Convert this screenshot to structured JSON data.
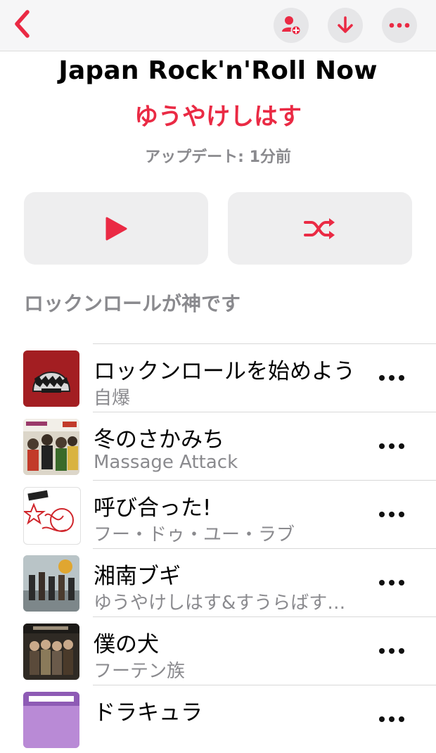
{
  "header": {
    "back_icon": "chevron-left-icon",
    "buttons": [
      "add-person-icon",
      "download-icon",
      "ellipsis-icon"
    ],
    "accent": "#ea2a44"
  },
  "playlist": {
    "title": "Japan Rock'n'Roll Now",
    "curator": "ゆうやけしはす",
    "updated": "アップデート: 1分前",
    "description": "ロックンロールが神です"
  },
  "actions": {
    "play_icon": "play-icon",
    "shuffle_icon": "shuffle-icon"
  },
  "tracks": [
    {
      "title": "ロックンロールを始めよう",
      "artist": "自爆"
    },
    {
      "title": "冬のさかみち",
      "artist": "Massage Attack"
    },
    {
      "title": "呼び合った!",
      "artist": "フー・ドゥ・ユー・ラブ"
    },
    {
      "title": "湘南ブギ",
      "artist": "ゆうやけしはす&すうらばすちゃん"
    },
    {
      "title": "僕の犬",
      "artist": "フーテン族"
    },
    {
      "title": "ドラキュラ",
      "artist": ""
    }
  ]
}
